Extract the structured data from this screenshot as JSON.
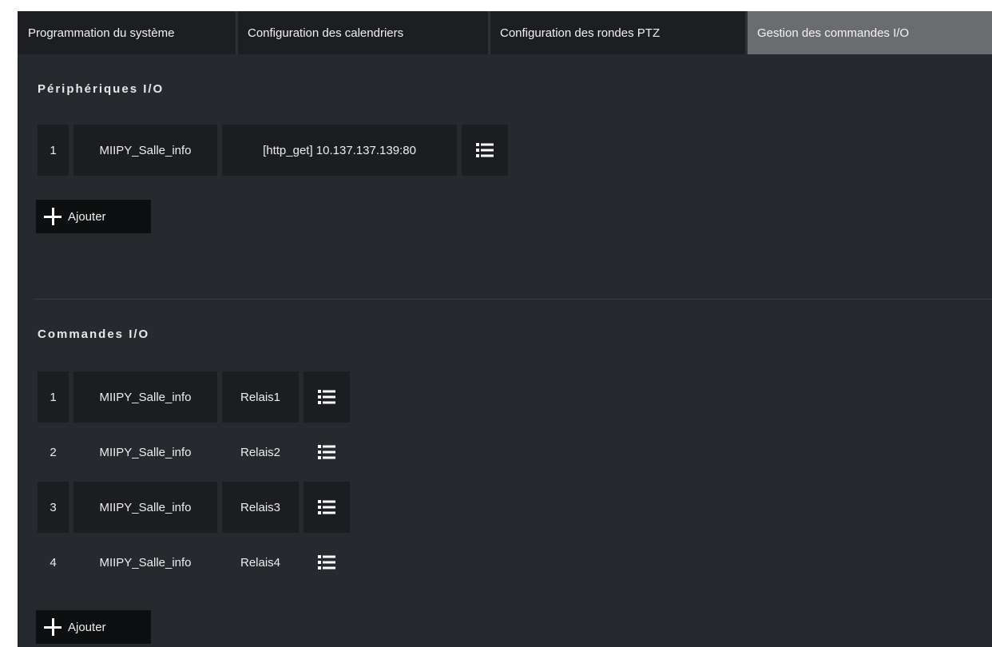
{
  "tabs": [
    {
      "label": "Programmation du système",
      "active": false
    },
    {
      "label": "Configuration des calendriers",
      "active": false
    },
    {
      "label": "Configuration des rondes PTZ",
      "active": false
    },
    {
      "label": "Gestion des commandes I/O",
      "active": true
    }
  ],
  "peripherals": {
    "title": "Périphériques I/O",
    "rows": [
      {
        "num": "1",
        "name": "MIIPY_Salle_info",
        "address": "[http_get] 10.137.137.139:80",
        "menu_icon": "list-icon"
      }
    ],
    "add_label": "Ajouter"
  },
  "commands": {
    "title": "Commandes I/O",
    "rows": [
      {
        "num": "1",
        "name": "MIIPY_Salle_info",
        "relay": "Relais1",
        "menu_icon": "list-icon"
      },
      {
        "num": "2",
        "name": "MIIPY_Salle_info",
        "relay": "Relais2",
        "menu_icon": "list-icon"
      },
      {
        "num": "3",
        "name": "MIIPY_Salle_info",
        "relay": "Relais3",
        "menu_icon": "list-icon"
      },
      {
        "num": "4",
        "name": "MIIPY_Salle_info",
        "relay": "Relais4",
        "menu_icon": "list-icon"
      }
    ],
    "add_label": "Ajouter"
  },
  "colors": {
    "panel_bg": "#26292d",
    "cell_bg": "#1b1d20",
    "active_tab_bg": "#6a6c6f",
    "button_bg": "#0e0f10"
  }
}
